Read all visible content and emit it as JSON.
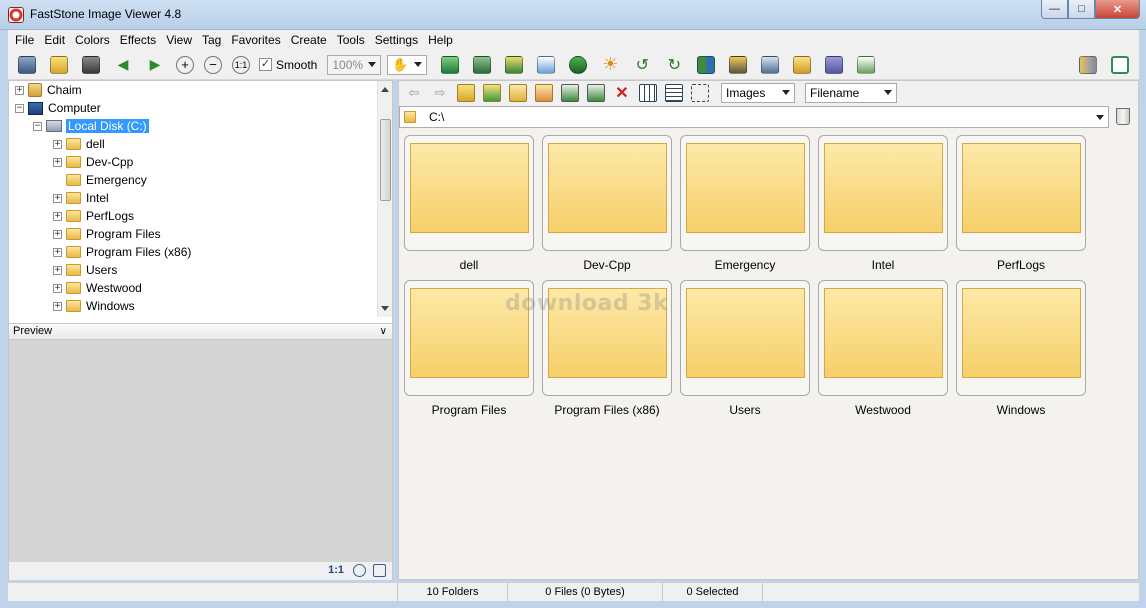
{
  "window": {
    "title": "FastStone Image Viewer 4.8"
  },
  "menu": [
    "File",
    "Edit",
    "Colors",
    "Effects",
    "View",
    "Tag",
    "Favorites",
    "Create",
    "Tools",
    "Settings",
    "Help"
  ],
  "toolbar": {
    "smooth_label": "Smooth",
    "smooth_checked": "✓",
    "zoom_value": "100%"
  },
  "tree": {
    "items": [
      {
        "label": "Chaim",
        "icon": "user-folder-icon"
      },
      {
        "label": "Computer",
        "icon": "computer-icon"
      },
      {
        "label": "Local Disk (C:)",
        "icon": "drive-icon",
        "selected": true
      },
      {
        "label": "dell"
      },
      {
        "label": "Dev-Cpp"
      },
      {
        "label": "Emergency"
      },
      {
        "label": "Intel"
      },
      {
        "label": "PerfLogs"
      },
      {
        "label": "Program Files"
      },
      {
        "label": "Program Files (x86)"
      },
      {
        "label": "Users"
      },
      {
        "label": "Westwood"
      },
      {
        "label": "Windows"
      }
    ]
  },
  "preview": {
    "title": "Preview",
    "ratio_label": "1:1"
  },
  "browser": {
    "filter_value": "Images",
    "sort_value": "Filename",
    "path": "C:\\"
  },
  "thumbnails": [
    {
      "label": "dell"
    },
    {
      "label": "Dev-Cpp"
    },
    {
      "label": "Emergency"
    },
    {
      "label": "Intel"
    },
    {
      "label": "PerfLogs"
    },
    {
      "label": "Program Files"
    },
    {
      "label": "Program Files (x86)"
    },
    {
      "label": "Users"
    },
    {
      "label": "Westwood"
    },
    {
      "label": "Windows"
    }
  ],
  "watermark": "download 3k",
  "status": {
    "folders": "10 Folders",
    "files": "0 Files (0 Bytes)",
    "selected": "0 Selected"
  }
}
